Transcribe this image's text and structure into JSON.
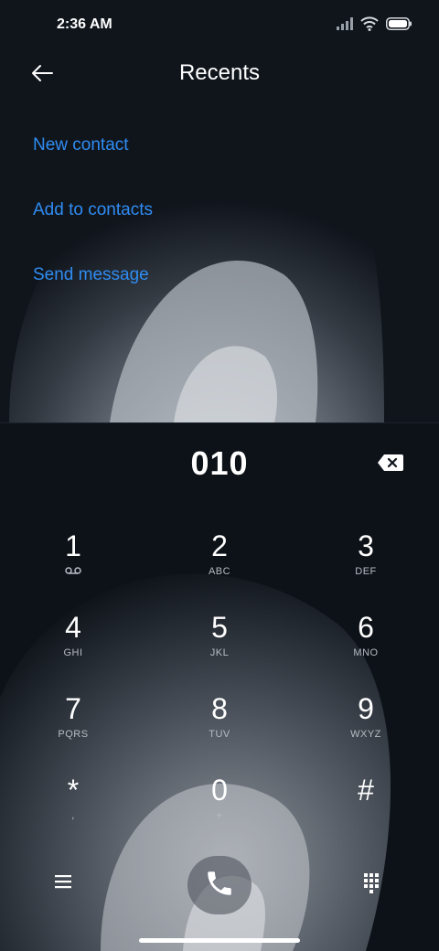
{
  "status": {
    "time": "2:36 AM",
    "icons": [
      "signal-icon",
      "wifi-icon",
      "battery-icon"
    ]
  },
  "header": {
    "title": "Recents",
    "back_icon": "back-arrow-icon"
  },
  "actions": [
    {
      "label": "New contact"
    },
    {
      "label": "Add to contacts"
    },
    {
      "label": "Send message"
    }
  ],
  "dialer": {
    "number": "010",
    "backspace_icon": "backspace-icon",
    "keys": [
      {
        "digit": "1",
        "letters": ""
      },
      {
        "digit": "2",
        "letters": "ABC"
      },
      {
        "digit": "3",
        "letters": "DEF"
      },
      {
        "digit": "4",
        "letters": "GHI"
      },
      {
        "digit": "5",
        "letters": "JKL"
      },
      {
        "digit": "6",
        "letters": "MNO"
      },
      {
        "digit": "7",
        "letters": "PQRS"
      },
      {
        "digit": "8",
        "letters": "TUV"
      },
      {
        "digit": "9",
        "letters": "WXYZ"
      },
      {
        "digit": "*",
        "letters": ","
      },
      {
        "digit": "0",
        "letters": "+"
      },
      {
        "digit": "#",
        "letters": ""
      }
    ]
  },
  "bottom": {
    "menu_icon": "menu-icon",
    "call_icon": "phone-icon",
    "dialpad_icon": "dialpad-icon"
  },
  "colors": {
    "accent": "#2f8cf2",
    "text": "#ffffff",
    "background": "#0d1218"
  }
}
